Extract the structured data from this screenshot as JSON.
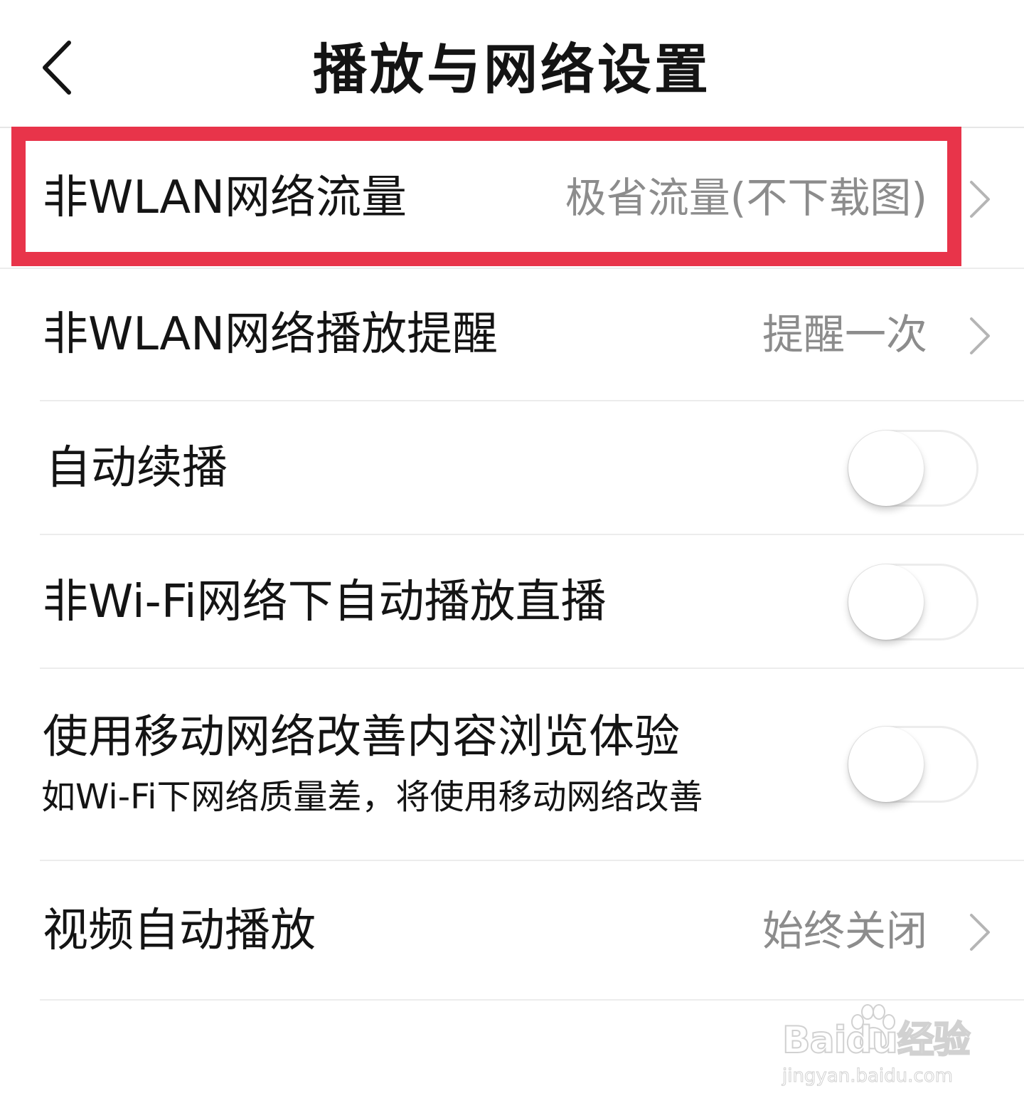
{
  "header": {
    "title": "播放与网络设置",
    "back_icon": "chevron-left-icon"
  },
  "settings": [
    {
      "label": "非WLAN网络流量",
      "value": "极省流量(不下载图)",
      "control": "chevron",
      "highlighted": true
    },
    {
      "label": "非WLAN网络播放提醒",
      "value": "提醒一次",
      "control": "chevron"
    },
    {
      "label": "自动续播",
      "control": "toggle",
      "on": false
    },
    {
      "label": "非Wi-Fi网络下自动播放直播",
      "control": "toggle",
      "on": false
    },
    {
      "label": "使用移动网络改善内容浏览体验",
      "sublabel": "如Wi-Fi下网络质量差，将使用移动网络改善",
      "control": "toggle",
      "on": false
    },
    {
      "label": "视频自动播放",
      "value": "始终关闭",
      "control": "chevron"
    }
  ],
  "watermark": {
    "brand": "Baidu经验",
    "url": "jingyan.baidu.com"
  },
  "colors": {
    "highlight": "#e8344a",
    "value_text": "#8c8c8c",
    "primary_text": "#141414",
    "divider": "#ececec"
  }
}
